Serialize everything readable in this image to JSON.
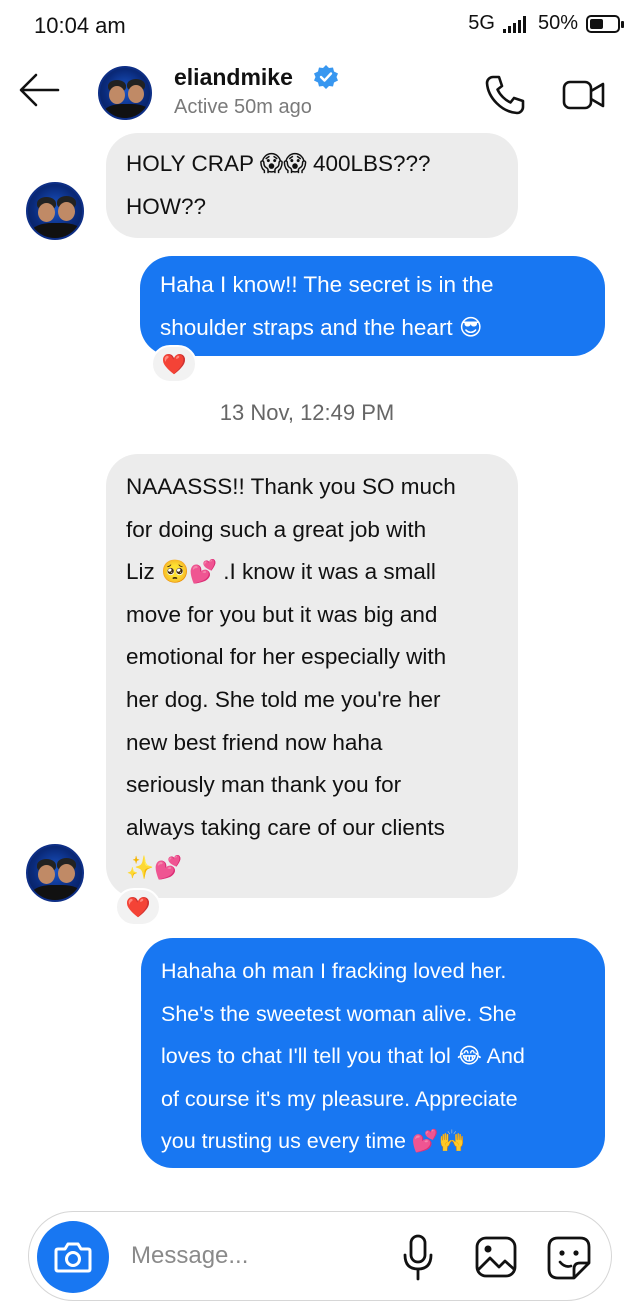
{
  "status_bar": {
    "time": "10:04 am",
    "network": "5G",
    "battery": "50%",
    "battery_level": 0.5
  },
  "header": {
    "username": "eliandmike",
    "status": "Active 50m ago",
    "verified": true,
    "icons": [
      "back-arrow-icon",
      "verified-badge-icon",
      "phone-icon",
      "video-camera-icon"
    ]
  },
  "messages": [
    {
      "direction": "incoming",
      "lines": [
        "HOLY CRAP 😱😱 400LBS???",
        "HOW??"
      ]
    },
    {
      "direction": "outgoing",
      "lines": [
        "Haha I know!! The secret is in the",
        "shoulder straps and the heart 😎"
      ],
      "reaction": "❤️"
    },
    {
      "direction": "timestamp",
      "text": "13 Nov, 12:49 PM"
    },
    {
      "direction": "incoming",
      "lines": [
        "NAAASSS!! Thank you SO much",
        "for doing such a great job with",
        "Liz 🥺💕 .I know it was a small",
        "move for you but it was big and",
        "emotional for her especially with",
        "her dog. She told me you're her",
        "new best friend now haha",
        "seriously man thank you for",
        "always taking care of our clients",
        "✨💕"
      ],
      "reaction": "❤️"
    },
    {
      "direction": "outgoing",
      "lines": [
        "Hahaha oh man I fracking loved her.",
        "She's the sweetest woman alive. She",
        "loves to chat I'll tell you that lol 😂 And",
        "of course it's my pleasure. Appreciate",
        "you trusting us every time  💕🙌"
      ]
    }
  ],
  "composer": {
    "placeholder": "Message...",
    "icons": [
      "camera-icon",
      "microphone-icon",
      "gallery-icon",
      "sticker-icon"
    ]
  },
  "colors": {
    "outgoing_bubble": "#1877f2",
    "incoming_bubble": "#ececec",
    "reaction_heart": "#e5263b"
  }
}
